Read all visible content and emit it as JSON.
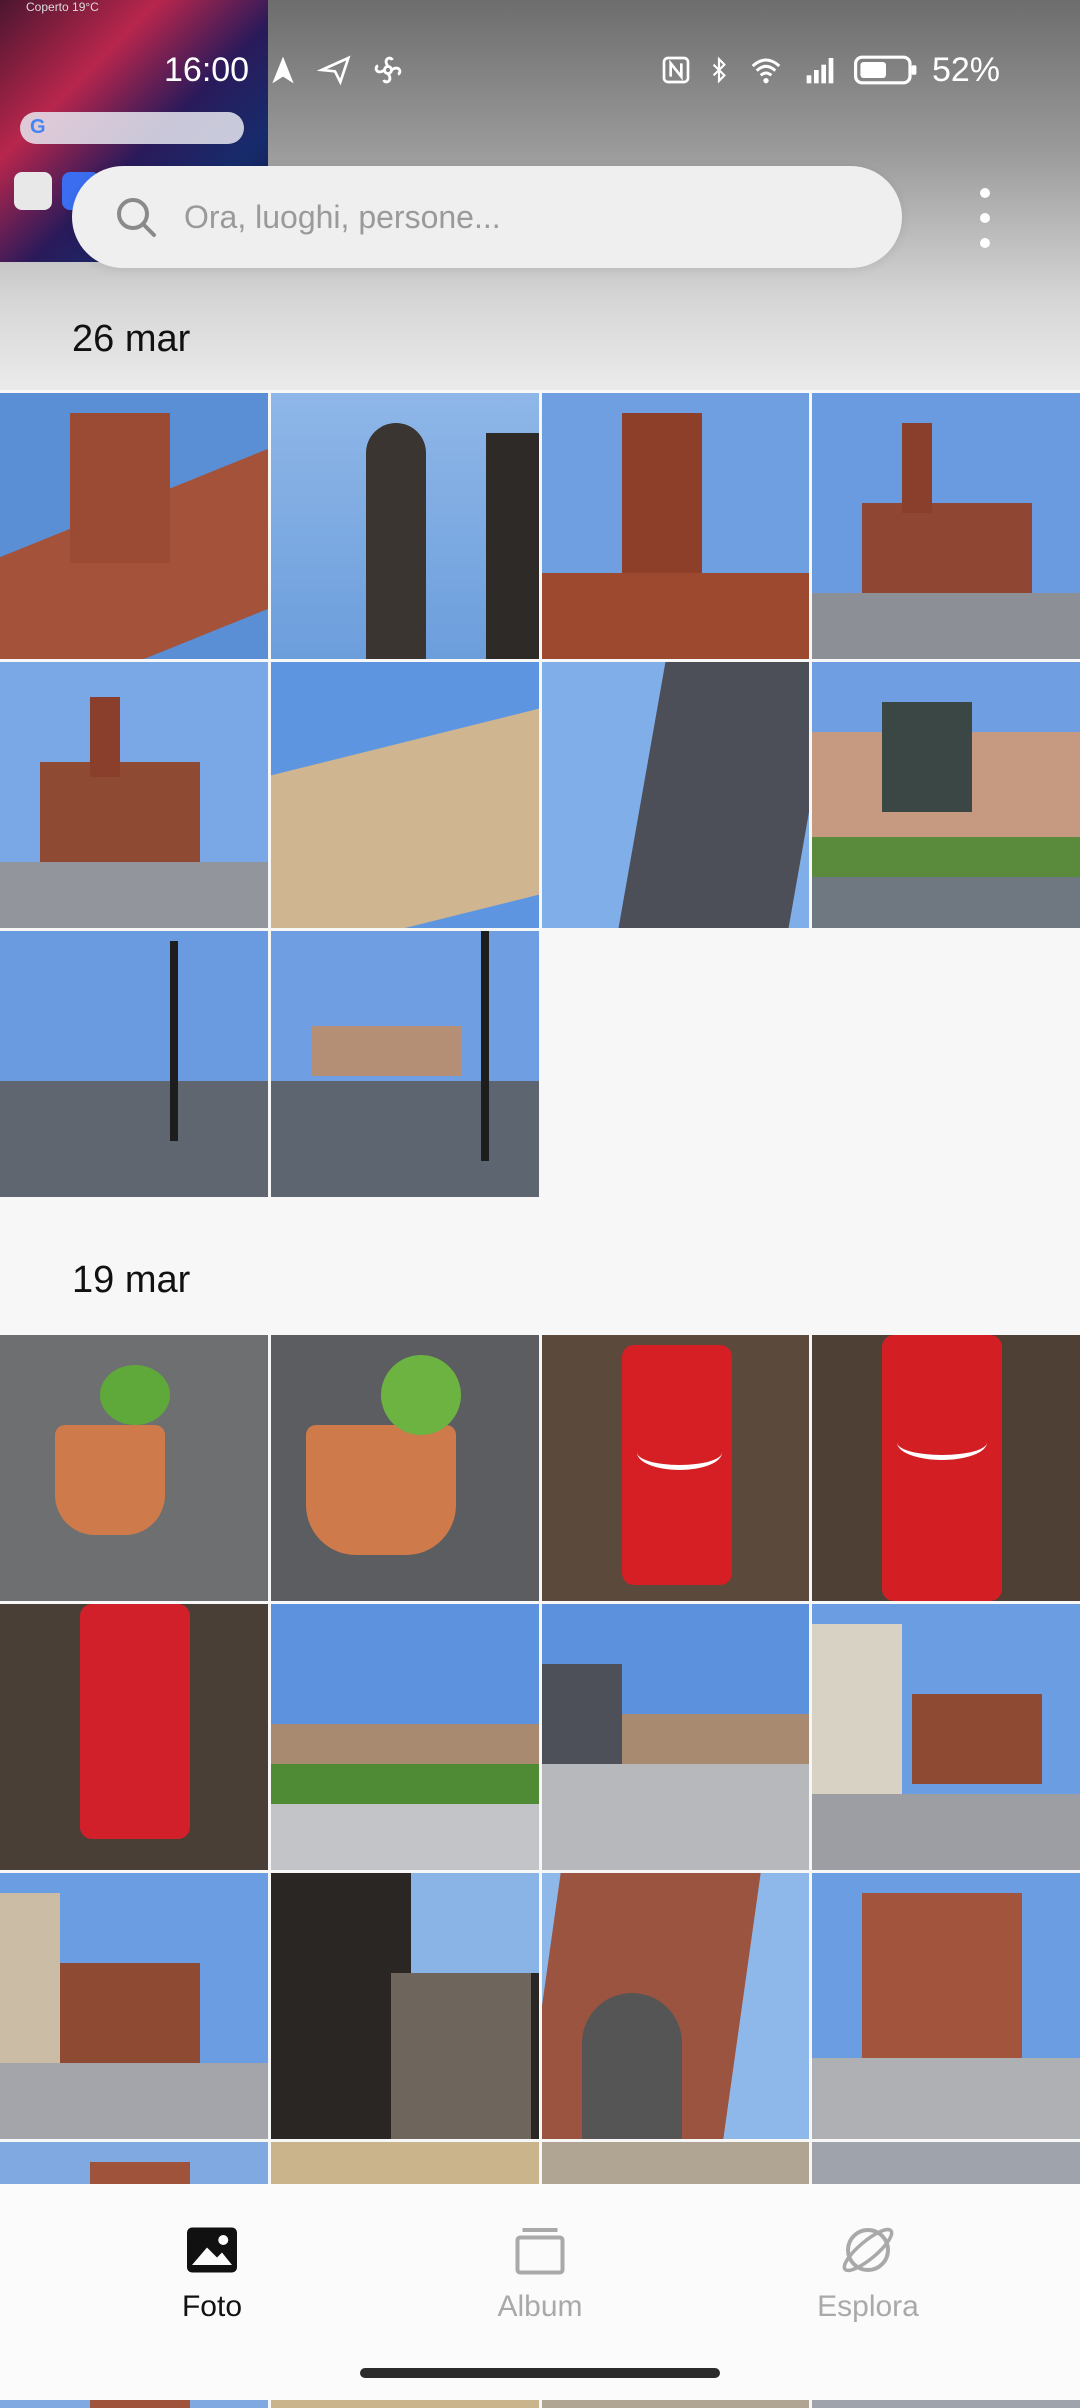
{
  "status_bar": {
    "time": "16:00",
    "battery_percent": "52%",
    "left_icons": [
      "navigation-arrow-icon",
      "send-icon",
      "fan-icon"
    ],
    "right_icons": [
      "nfc-icon",
      "bluetooth-icon",
      "wifi-icon",
      "signal-icon",
      "battery-icon"
    ]
  },
  "pip_preview": {
    "weather_text": "Coperto 19°C"
  },
  "search": {
    "placeholder": "Ora, luoghi, persone..."
  },
  "sections": [
    {
      "date": "26 mar",
      "photos": [
        "brick-tower-closeup",
        "silhouette-dome",
        "brick-tower-blue-sky",
        "broletto-square",
        "broletto-arcade",
        "yellow-building",
        "modern-building",
        "equestrian-monument",
        "lamp-post-square",
        "lamp-post-monument"
      ]
    },
    {
      "date": "19 mar",
      "photos": [
        "potted-plant-1",
        "potted-plant-2",
        "coca-cola-can-1",
        "coca-cola-can-2",
        "coca-cola-can-3",
        "monument-park-1",
        "monument-park-2",
        "street-tower-1",
        "street-tower-2",
        "narrow-street",
        "gothic-arch",
        "brick-loggia",
        "partial-row-1",
        "partial-row-2",
        "partial-row-3",
        "partial-row-4"
      ]
    }
  ],
  "nav": {
    "items": [
      {
        "label": "Foto",
        "icon": "photo-icon",
        "active": true
      },
      {
        "label": "Album",
        "icon": "album-icon",
        "active": false
      },
      {
        "label": "Esplora",
        "icon": "explore-planet-icon",
        "active": false
      }
    ]
  },
  "colors": {
    "nav_active": "#111111",
    "nav_inactive": "#a9a9a9",
    "background": "#f7f7f7"
  }
}
